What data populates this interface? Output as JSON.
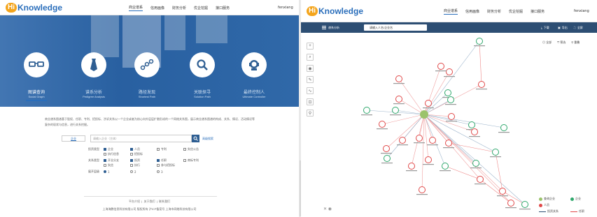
{
  "logo": {
    "hi": "Hi",
    "knowledge": "Knowledge"
  },
  "nav": [
    "商业谱系",
    "信用画像",
    "财务分析",
    "优企挖掘",
    "接口服务"
  ],
  "user": "fenxiang",
  "features": [
    {
      "title": "图谱查询",
      "sub": "Social Graph"
    },
    {
      "title": "谱系分析",
      "sub": "Pedigree Analysis"
    },
    {
      "title": "路径发现",
      "sub": "Shortest Path"
    },
    {
      "title": "关联探寻",
      "sub": "Solution Path"
    },
    {
      "title": "最终控制人",
      "sub": "Ultimate Controller"
    }
  ],
  "description": "商业谱系图谱基于股权、任职、专利、招投标、涉诉关系以一个企业或者为核心向外层层扩散形成的一个网络关系图，展示商业谱系图谱的构成、关系、情况、活动情况等复杂的现状与信息，进行关系挖掘。",
  "search": {
    "select": "企业",
    "placeholder": "请输入企业（主体）",
    "advanced": "高级搜索"
  },
  "filter": {
    "type_label": "投资类型",
    "types": [
      "企业",
      "人员",
      "专利",
      "失信公告",
      "执行信息",
      "招投标"
    ],
    "relation_label": "关系类型",
    "relations": [
      "开业分支",
      "投资",
      "任职",
      "商标专利",
      "失信",
      "执行",
      "参与招投标"
    ],
    "depth_label": "展开层级",
    "depths": [
      "1",
      "2",
      "3"
    ]
  },
  "footer": {
    "links": [
      "平台介绍",
      "关于我们",
      "联系我们"
    ],
    "copyright": "上海海鹏信息科技有限公司 版权所有 沪ICP备案号 上海市网络科技有限公司"
  },
  "graph": {
    "toolbar_title": "谱系分析",
    "search_placeholder": "请输入人名/企业名",
    "tools": [
      "下载",
      "导出",
      "全屏"
    ],
    "view_tools": [
      "全部",
      "筛选",
      "重叠"
    ],
    "left_tools": [
      "+",
      "⌕",
      "◉",
      "✎",
      "∿",
      "⊡",
      "⚲"
    ],
    "legend": [
      {
        "label": "查询企业",
        "color": "#9bc36b"
      },
      {
        "label": "企业",
        "color": "#2fa86c"
      },
      {
        "label": "人员",
        "color": "#e04848"
      },
      {
        "label": "投资关系",
        "color": "#2d4e73"
      },
      {
        "label": "任职",
        "color": "#e04848"
      }
    ],
    "center_color": "#9bc36b",
    "company_color": "#2fa86c",
    "person_color": "#e04848"
  }
}
